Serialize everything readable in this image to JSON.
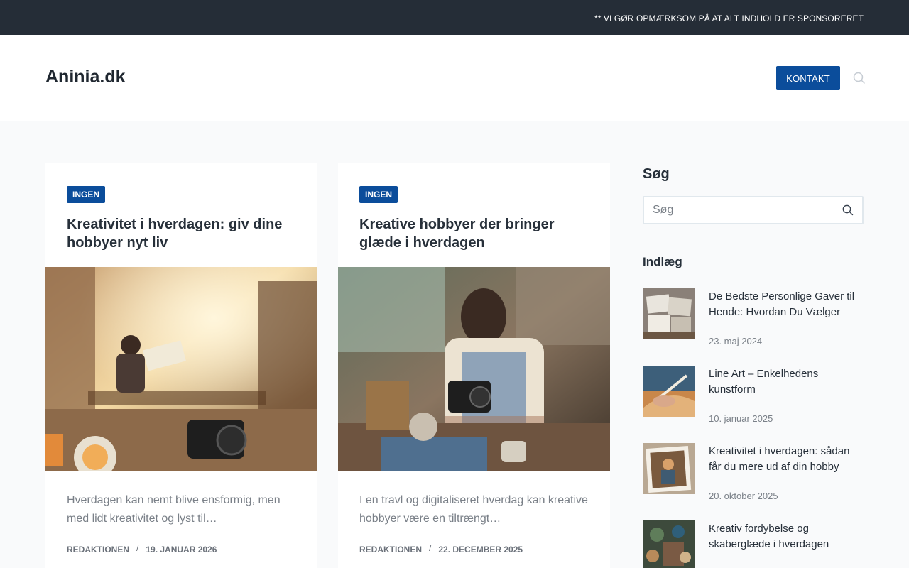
{
  "topbar": {
    "notice": "** VI GØR OPMÆRKSOM PÅ AT ALT INDHOLD ER SPONSORERET"
  },
  "header": {
    "logo": "Aninia.dk",
    "contact_label": "KONTAKT"
  },
  "articles": [
    {
      "category": "INGEN",
      "title": "Kreativitet i hverdagen: giv dine hobbyer nyt liv",
      "excerpt": "Hverdagen kan nemt blive ensformig, men med lidt kreativitet og lyst til…",
      "author": "REDAKTIONEN",
      "date": "19. JANUAR 2026"
    },
    {
      "category": "INGEN",
      "title": "Kreative hobbyer der bringer glæde i hverdagen",
      "excerpt": "I en travl og digitaliseret hverdag kan kreative hobbyer være en tiltrængt…",
      "author": "REDAKTIONEN",
      "date": "22. DECEMBER 2025"
    }
  ],
  "sidebar": {
    "search_heading": "Søg",
    "search_placeholder": "Søg",
    "posts_heading": "Indlæg",
    "posts": [
      {
        "title": "De Bedste Personlige Gaver til Hende: Hvordan Du Vælger",
        "date": "23. maj 2024"
      },
      {
        "title": "Line Art – Enkelhedens kunstform",
        "date": "10. januar 2025"
      },
      {
        "title": "Kreativitet i hverdagen: sådan får du mere ud af din hobby",
        "date": "20. oktober 2025"
      },
      {
        "title": "Kreativ fordybelse og skaberglæde i hverdagen",
        "date": ""
      }
    ]
  },
  "colors": {
    "topbar": "#252d37",
    "accent": "#0b4d9b",
    "background": "#f9fafb"
  },
  "icons": {
    "search": "search-icon"
  }
}
